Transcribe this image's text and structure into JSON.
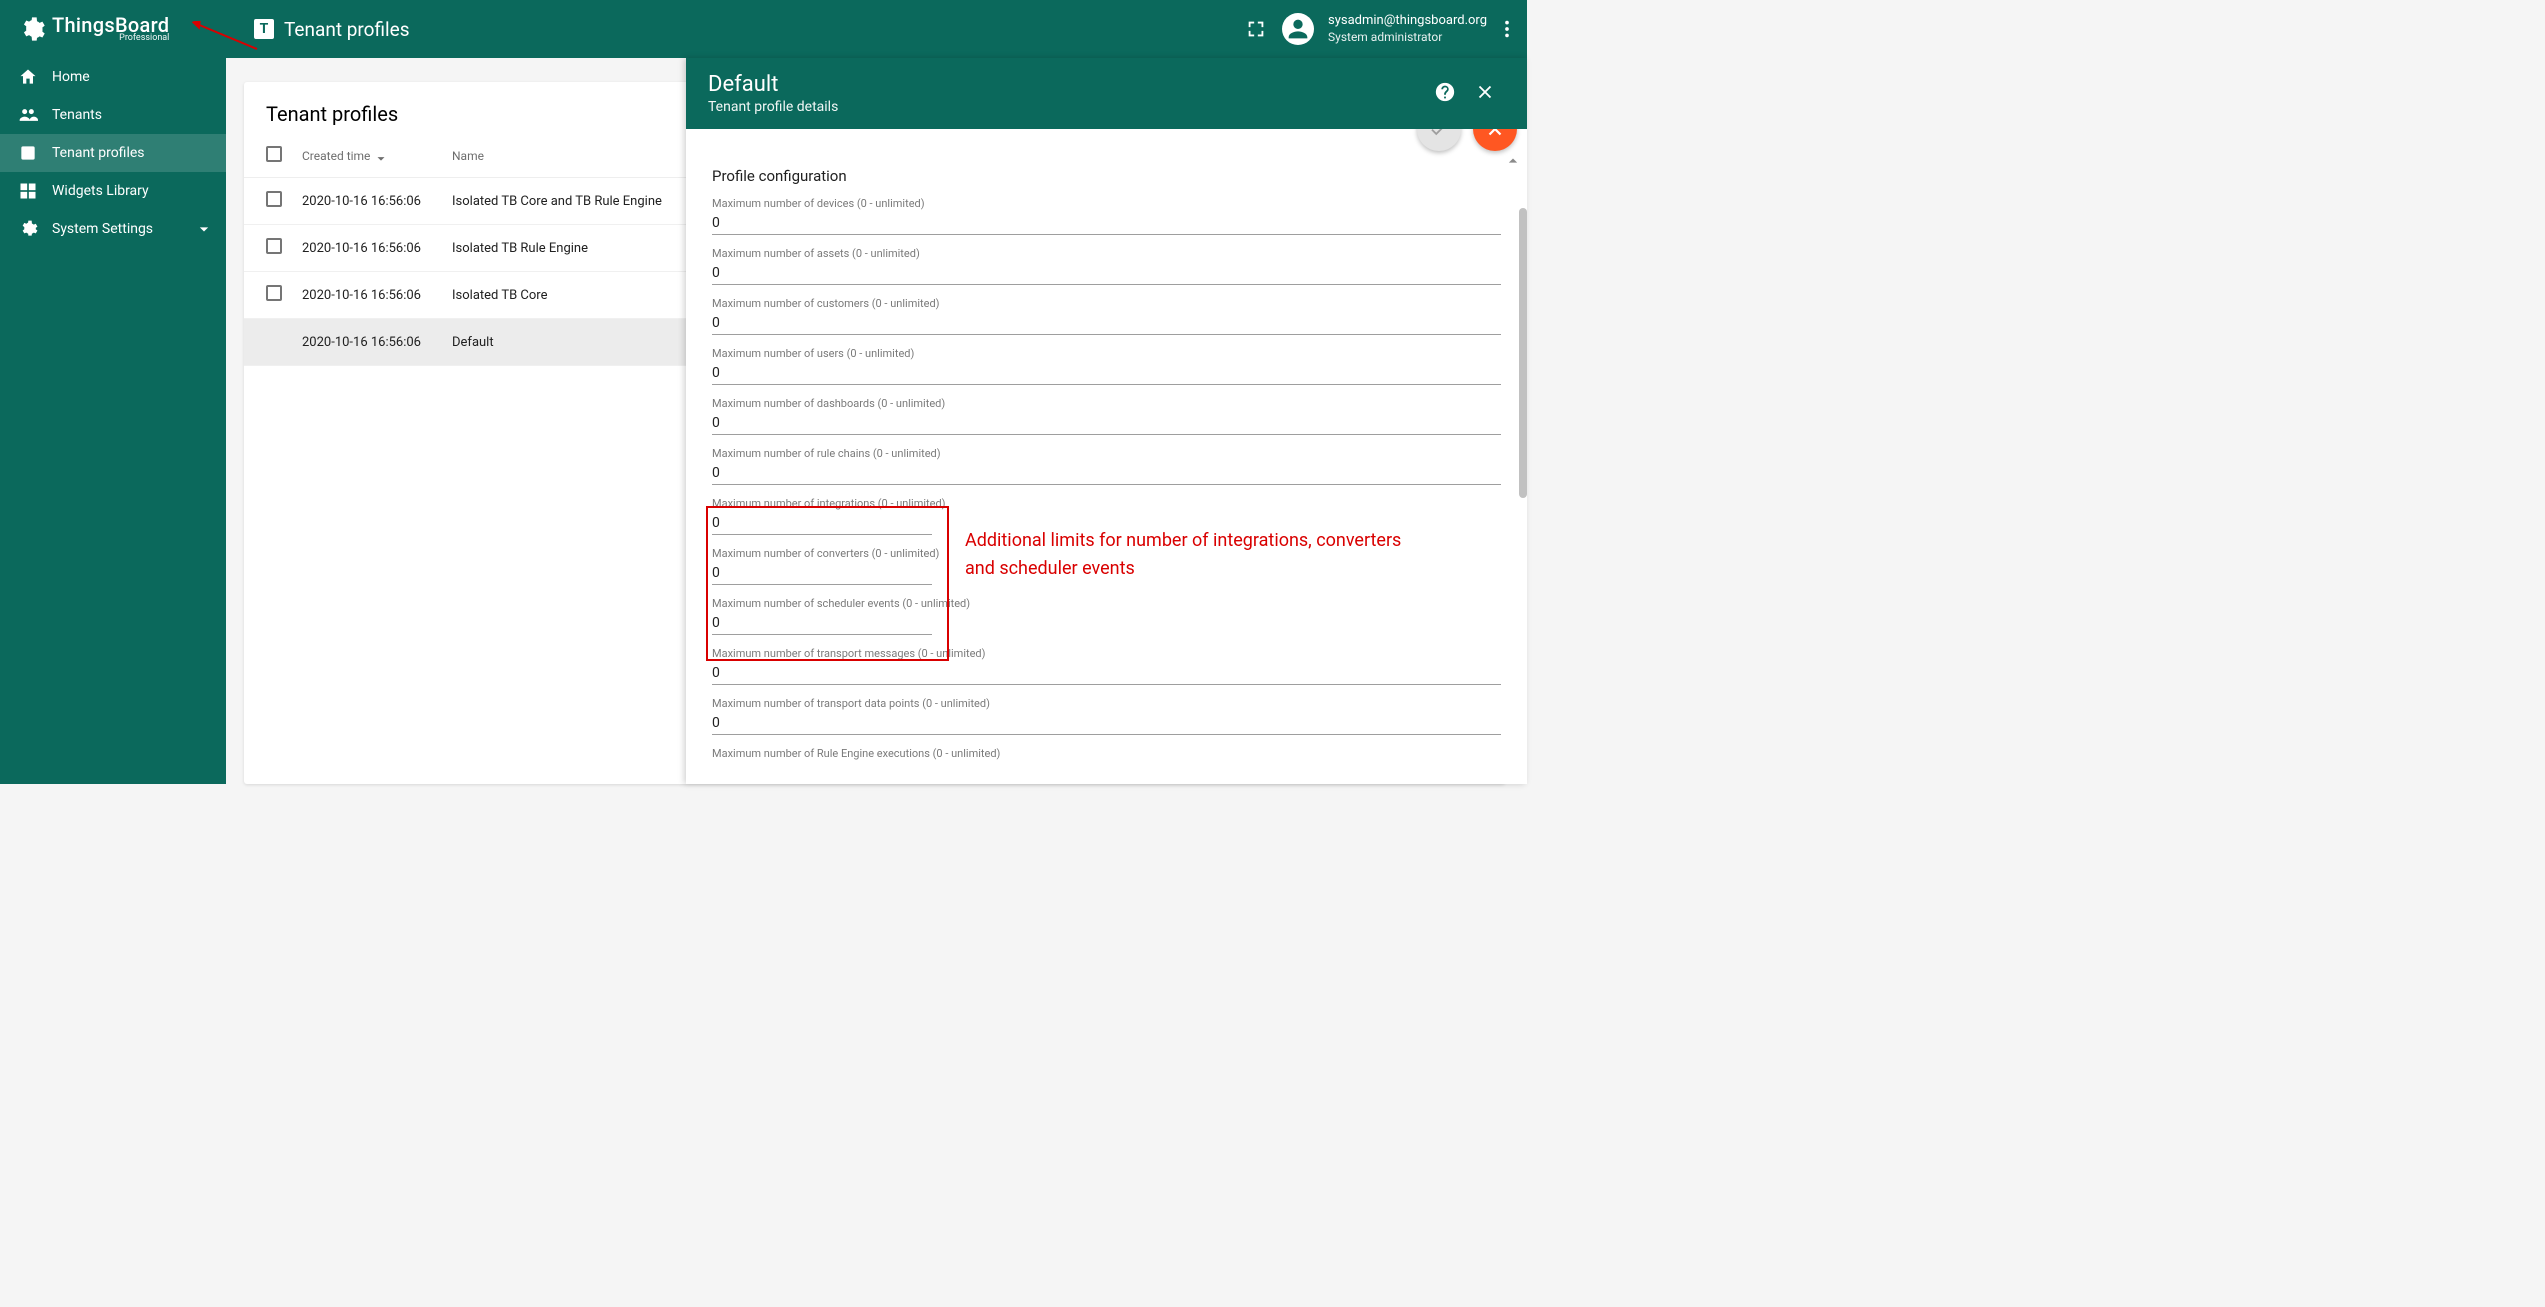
{
  "brand": {
    "name": "ThingsBoard",
    "edition": "Professional"
  },
  "page_title": "Tenant profiles",
  "user": {
    "email": "sysadmin@thingsboard.org",
    "role": "System administrator"
  },
  "sidebar": {
    "items": [
      {
        "label": "Home"
      },
      {
        "label": "Tenants"
      },
      {
        "label": "Tenant profiles"
      },
      {
        "label": "Widgets Library"
      },
      {
        "label": "System Settings"
      }
    ]
  },
  "list": {
    "heading": "Tenant profiles",
    "columns": {
      "created": "Created time",
      "name": "Name"
    },
    "rows": [
      {
        "time": "2020-10-16 16:56:06",
        "name": "Isolated TB Core and TB Rule Engine"
      },
      {
        "time": "2020-10-16 16:56:06",
        "name": "Isolated TB Rule Engine"
      },
      {
        "time": "2020-10-16 16:56:06",
        "name": "Isolated TB Core"
      },
      {
        "time": "2020-10-16 16:56:06",
        "name": "Default"
      }
    ]
  },
  "drawer": {
    "title": "Default",
    "subtitle": "Tenant profile details",
    "section": "Profile configuration",
    "fields": [
      {
        "label": "Maximum number of devices (0 - unlimited)",
        "value": "0"
      },
      {
        "label": "Maximum number of assets (0 - unlimited)",
        "value": "0"
      },
      {
        "label": "Maximum number of customers (0 - unlimited)",
        "value": "0"
      },
      {
        "label": "Maximum number of users (0 - unlimited)",
        "value": "0"
      },
      {
        "label": "Maximum number of dashboards (0 - unlimited)",
        "value": "0"
      },
      {
        "label": "Maximum number of rule chains (0 - unlimited)",
        "value": "0"
      },
      {
        "label": "Maximum number of integrations (0 - unlimited)",
        "value": "0"
      },
      {
        "label": "Maximum number of converters (0 - unlimited)",
        "value": "0"
      },
      {
        "label": "Maximum number of scheduler events (0 - unlimited)",
        "value": "0"
      },
      {
        "label": "Maximum number of transport messages (0 - unlimited)",
        "value": "0"
      },
      {
        "label": "Maximum number of transport data points (0 - unlimited)",
        "value": "0"
      },
      {
        "label": "Maximum number of Rule Engine executions (0 - unlimited)",
        "value": ""
      }
    ]
  },
  "annotation": {
    "text1": "Additional limits for number of integrations, converters",
    "text2": "and scheduler events"
  }
}
